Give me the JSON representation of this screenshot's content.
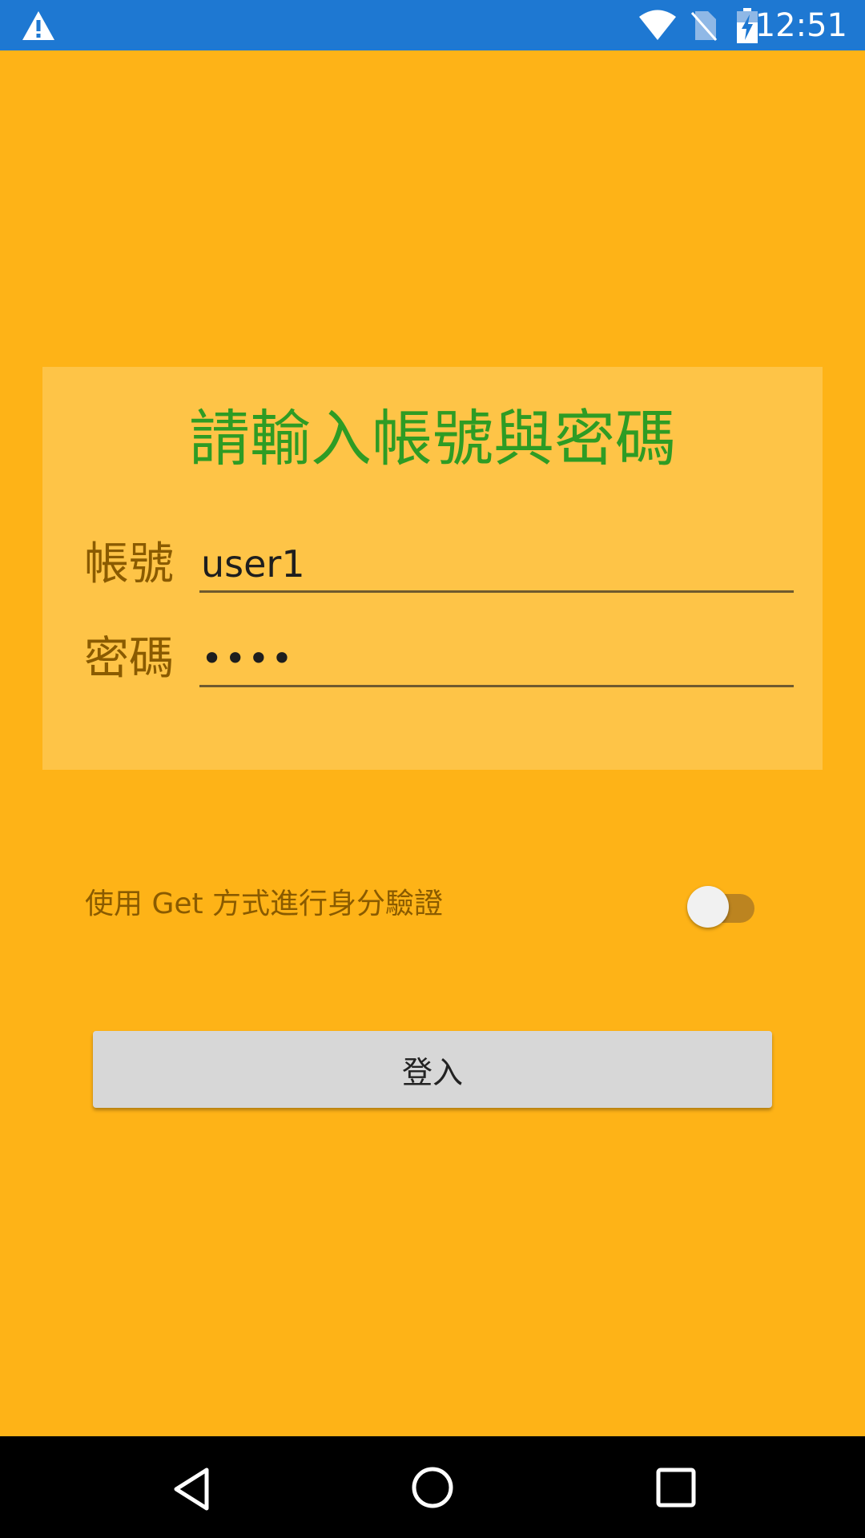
{
  "status_bar": {
    "time": "12:51",
    "icons": [
      "warning-icon",
      "wifi-icon",
      "no-sim-icon",
      "battery-charging-icon"
    ],
    "background_color": "#1E78D2"
  },
  "login_card": {
    "title": "請輸入帳號與密碼",
    "title_color": "#2E9C24",
    "account_label": "帳號",
    "account_value": "user1",
    "password_label": "密碼",
    "password_value": "••••"
  },
  "get_auth_switch": {
    "label": "使用 Get 方式進行身分驗證",
    "checked": false
  },
  "login_button": {
    "label": "登入"
  },
  "nav_bar": {
    "icons": [
      "back-icon",
      "home-icon",
      "recents-icon"
    ]
  },
  "colors": {
    "background": "#FEB317",
    "card": "#FEC447",
    "label": "#8A5B00"
  }
}
